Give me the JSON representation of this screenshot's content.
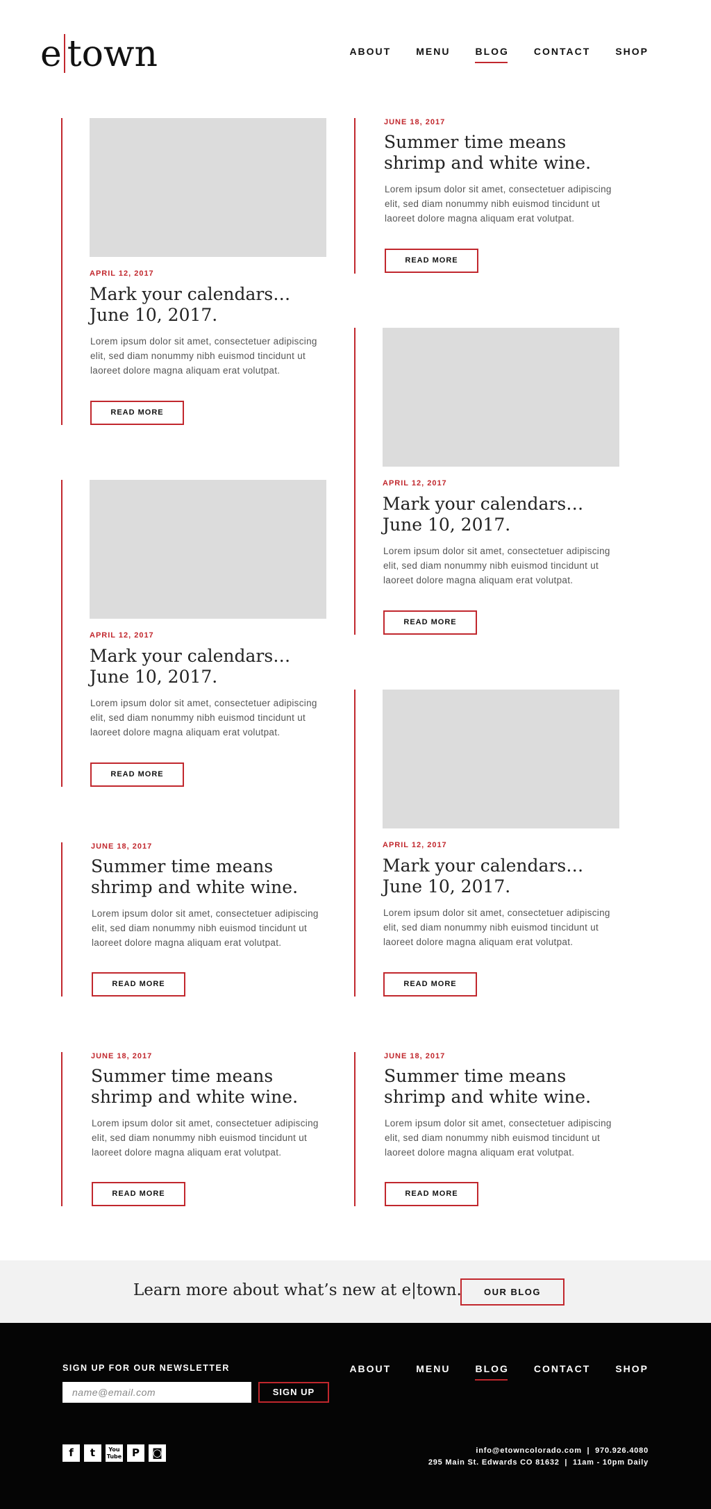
{
  "brand": {
    "logo_left": "e",
    "logo_right": "town",
    "accent": "#c1272d"
  },
  "nav": {
    "items": [
      {
        "label": "ABOUT"
      },
      {
        "label": "MENU"
      },
      {
        "label": "BLOG",
        "active": true
      },
      {
        "label": "CONTACT"
      },
      {
        "label": "SHOP"
      }
    ]
  },
  "posts": [
    {
      "date": "APRIL 12, 2017",
      "title": "Mark your calendars… June 10, 2017.",
      "excerpt": "Lorem ipsum dolor sit amet, consectetuer adipiscing elit, sed diam nonummy nibh euismod tincidunt ut laoreet dolore magna aliquam erat volutpat.",
      "button": "READ MORE"
    },
    {
      "date": "JUNE 18, 2017",
      "title": "Summer time means shrimp and white wine.",
      "excerpt": "Lorem ipsum dolor sit amet, consectetuer adipiscing elit, sed diam nonummy nibh euismod tincidunt ut laoreet dolore magna aliquam erat volutpat.",
      "button": "READ MORE"
    },
    {
      "date": "APRIL 12, 2017",
      "title": "Mark your calendars… June 10, 2017.",
      "excerpt": "Lorem ipsum dolor sit amet, consectetuer adipiscing elit, sed diam nonummy nibh euismod tincidunt ut laoreet dolore magna aliquam erat volutpat.",
      "button": "READ MORE"
    },
    {
      "date": "APRIL 12, 2017",
      "title": "Mark your calendars… June 10, 2017.",
      "excerpt": "Lorem ipsum dolor sit amet, consectetuer adipiscing elit, sed diam nonummy nibh euismod tincidunt ut laoreet dolore magna aliquam erat volutpat.",
      "button": "READ MORE"
    },
    {
      "date": "JUNE 18, 2017",
      "title": "Summer time means shrimp and white wine.",
      "excerpt": "Lorem ipsum dolor sit amet, consectetuer adipiscing elit, sed diam nonummy nibh euismod tincidunt ut laoreet dolore magna aliquam erat volutpat.",
      "button": "READ MORE"
    },
    {
      "date": "APRIL 12, 2017",
      "title": "Mark your calendars… June 10, 2017.",
      "excerpt": "Lorem ipsum dolor sit amet, consectetuer adipiscing elit, sed diam nonummy nibh euismod tincidunt ut laoreet dolore magna aliquam erat volutpat.",
      "button": "READ MORE"
    },
    {
      "date": "JUNE 18, 2017",
      "title": "Summer time means shrimp and white wine.",
      "excerpt": "Lorem ipsum dolor sit amet, consectetuer adipiscing elit, sed diam nonummy nibh euismod tincidunt ut laoreet dolore magna aliquam erat volutpat.",
      "button": "READ MORE"
    },
    {
      "date": "JUNE 18, 2017",
      "title": "Summer time means shrimp and white wine.",
      "excerpt": "Lorem ipsum dolor sit amet, consectetuer adipiscing elit, sed diam nonummy nibh euismod tincidunt ut laoreet dolore magna aliquam erat volutpat.",
      "button": "READ MORE"
    }
  ],
  "cta": {
    "text": "Learn more about what’s new at e|town.",
    "button": "OUR BLOG"
  },
  "footer": {
    "newsletter_label": "SIGN UP FOR OUR NEWSLETTER",
    "email_placeholder": "name@email.com",
    "signup_button": "SIGN UP",
    "nav": [
      {
        "label": "ABOUT"
      },
      {
        "label": "MENU"
      },
      {
        "label": "BLOG",
        "active": true
      },
      {
        "label": "CONTACT"
      },
      {
        "label": "SHOP"
      }
    ],
    "social": [
      {
        "icon": "facebook-icon",
        "glyph": "f"
      },
      {
        "icon": "twitter-icon",
        "glyph": "t"
      },
      {
        "icon": "youtube-icon",
        "glyph": "You Tube"
      },
      {
        "icon": "pinterest-icon",
        "glyph": "P"
      },
      {
        "icon": "instagram-icon",
        "glyph": "◙"
      }
    ],
    "contact_line1": "info@etowncolorado.com  |  970.926.4080",
    "contact_line2": "295 Main St. Edwards CO 81632  |  11am - 10pm Daily"
  }
}
